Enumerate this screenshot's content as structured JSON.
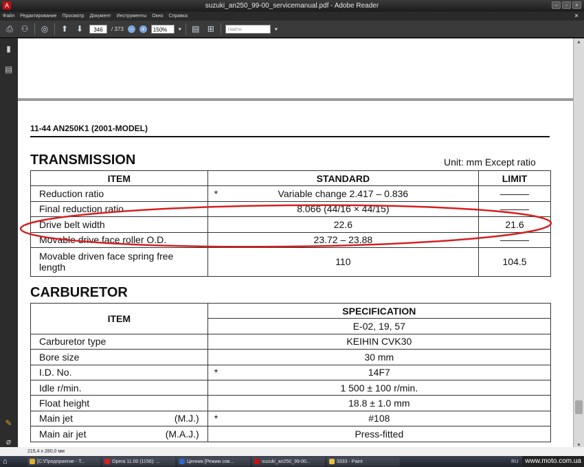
{
  "window": {
    "title": "suzuki_an250_99-00_servicemanual.pdf - Adobe Reader",
    "controls": [
      "–",
      "▫",
      "×"
    ]
  },
  "menu": {
    "items": [
      "Файл",
      "Редактирование",
      "Просмотр",
      "Документ",
      "Инструменты",
      "Окно",
      "Справка"
    ],
    "close_doc": "×"
  },
  "toolbar": {
    "current_page": "346",
    "total_pages": "/ 373",
    "zoom": "150%",
    "find_placeholder": "Найти"
  },
  "document": {
    "page_header": "11-44   AN250K1 (2001-MODEL)",
    "transmission": {
      "title": "TRANSMISSION",
      "unit_note": "Unit: mm Except ratio",
      "headers": [
        "ITEM",
        "STANDARD",
        "LIMIT"
      ],
      "rows": [
        {
          "item": "Reduction ratio",
          "mark": "*",
          "standard": "Variable change 2.417 – 0.836",
          "limit": "———"
        },
        {
          "item": "Final reduction ratio",
          "mark": "",
          "standard": "8.066 (44/16 × 44/15)",
          "limit": "———"
        },
        {
          "item": "Drive belt width",
          "mark": "",
          "standard": "22.6",
          "limit": "21.6"
        },
        {
          "item": "Movable drive face roller O.D.",
          "mark": "",
          "standard": "23.72 – 23.88",
          "limit": "———"
        },
        {
          "item": "Movable driven face spring free length",
          "mark": "",
          "standard": "110",
          "limit": "104.5"
        }
      ]
    },
    "carburetor": {
      "title": "CARBURETOR",
      "headers": {
        "item": "ITEM",
        "spec": "SPECIFICATION",
        "models": "E-02, 19, 57"
      },
      "rows": [
        {
          "item": "Carburetor type",
          "abbr": "",
          "mark": "",
          "spec": "KEIHIN CVK30"
        },
        {
          "item": "Bore size",
          "abbr": "",
          "mark": "",
          "spec": "30 mm"
        },
        {
          "item": "I.D. No.",
          "abbr": "",
          "mark": "*",
          "spec": "14F7"
        },
        {
          "item": "Idle r/min.",
          "abbr": "",
          "mark": "",
          "spec": "1 500 ± 100 r/min."
        },
        {
          "item": "Float height",
          "abbr": "",
          "mark": "",
          "spec": "18.8 ± 1.0 mm"
        },
        {
          "item": "Main jet",
          "abbr": "(M.J.)",
          "mark": "*",
          "spec": "#108"
        },
        {
          "item": "Main air jet",
          "abbr": "(M.A.J.)",
          "mark": "",
          "spec": "Press-fitted"
        }
      ]
    },
    "annotation_color": "#d42020"
  },
  "statusbar": {
    "page_size": "215,4 x 280,0 мм"
  },
  "taskbar": {
    "tasks": [
      {
        "label": "[C:\\Предприятие - T...",
        "color": "#e0b030"
      },
      {
        "label": "Opera 11.00 (1156): ...",
        "color": "#d02020"
      },
      {
        "label": "Ценник [Режим сов...",
        "color": "#2a6ad0"
      },
      {
        "label": "suzuki_an250_99-00...",
        "color": "#c01010"
      },
      {
        "label": "3333 - Paint",
        "color": "#e8c040"
      }
    ],
    "lang": "RU",
    "watermark": "www.moto.com.ua"
  }
}
